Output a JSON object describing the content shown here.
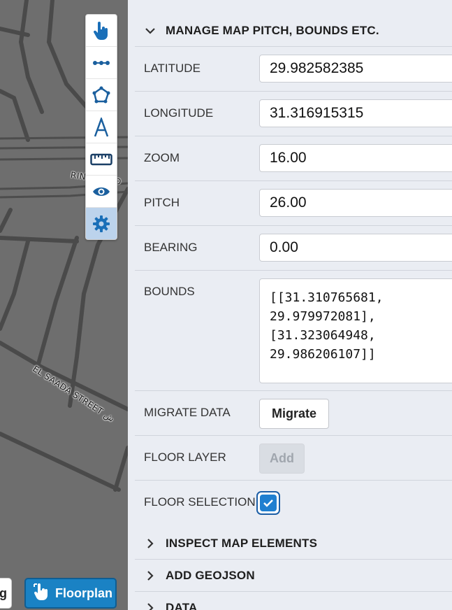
{
  "map": {
    "labels": [
      "RING ROAD",
      "EL SAADA STREET ش"
    ]
  },
  "toolbar": {
    "tools": [
      {
        "icon": "hand-pointer-icon",
        "active": false
      },
      {
        "icon": "polyline-icon",
        "active": false
      },
      {
        "icon": "polygon-icon",
        "active": false
      },
      {
        "icon": "text-tool-icon",
        "active": false
      },
      {
        "icon": "ruler-icon",
        "active": false
      },
      {
        "icon": "eye-icon",
        "active": false
      },
      {
        "icon": "gear-icon",
        "active": true
      }
    ]
  },
  "bottom": {
    "partial_button_text": "g",
    "floorplan_label": "Floorplan"
  },
  "panel": {
    "manage_header": "MANAGE MAP PITCH, BOUNDS ETC.",
    "fields": {
      "latitude": {
        "label": "LATITUDE",
        "value": "29.982582385"
      },
      "longitude": {
        "label": "LONGITUDE",
        "value": "31.316915315"
      },
      "zoom": {
        "label": "ZOOM",
        "value": "16.00"
      },
      "pitch": {
        "label": "PITCH",
        "value": "26.00"
      },
      "bearing": {
        "label": "BEARING",
        "value": "0.00"
      },
      "bounds": {
        "label": "BOUNDS",
        "value": "[[31.310765681,\n29.979972081],\n[31.323064948,\n29.986206107]]"
      }
    },
    "migrate": {
      "label": "MIGRATE DATA",
      "button": "Migrate"
    },
    "floor_layer": {
      "label": "FLOOR LAYER",
      "button": "Add",
      "disabled": true
    },
    "floor_selection": {
      "label": "FLOOR SELECTION",
      "checked": true
    },
    "sections": [
      {
        "title": "INSPECT MAP ELEMENTS",
        "expanded": false
      },
      {
        "title": "ADD GEOJSON",
        "expanded": false
      },
      {
        "title": "DATA",
        "expanded": false
      }
    ]
  },
  "colors": {
    "accent": "#1f7fd0",
    "active_tool_bg": "#bcd3ec",
    "panel_bg": "#eaedf3",
    "map_bg": "#6e6e6e"
  }
}
